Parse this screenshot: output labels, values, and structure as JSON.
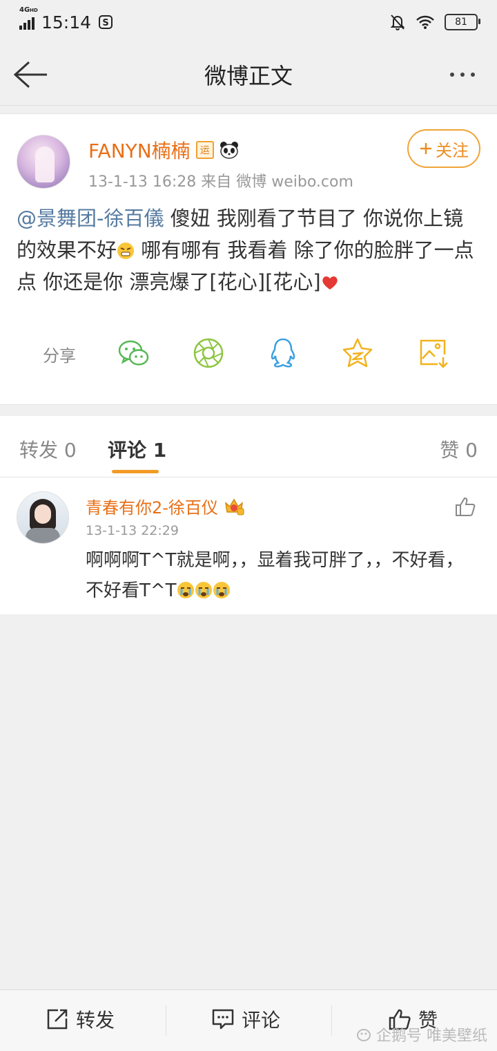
{
  "status_bar": {
    "network": "4G",
    "network_sub": "HD",
    "time": "15:14",
    "battery": "81"
  },
  "title_bar": {
    "title": "微博正文"
  },
  "post": {
    "username": "FANYN楠楠",
    "badge": "运",
    "meta": "13-1-13 16:28   来自 微博 weibo.com",
    "follow_label": "关注",
    "mention": "@景舞团-徐百儀",
    "text_a": " 傻妞 我刚看了节目了 你说你上镜的效果不好",
    "text_b": " 哪有哪有 我看着 除了你的脸胖了一点点 你还是你 漂亮爆了[花心][花心]"
  },
  "share": {
    "label": "分享",
    "icons": [
      "wechat-icon",
      "moments-icon",
      "qq-icon",
      "qzone-icon",
      "save-image-icon"
    ]
  },
  "tabs": {
    "repost": "转发 0",
    "comment": "评论 1",
    "like": "赞 0"
  },
  "comment": {
    "username": "青春有你2-徐百仪",
    "time": "13-1-13 22:29",
    "text": "啊啊啊T^T就是啊，，显着我可胖了，，不好看，不好看T^T"
  },
  "bottom_bar": {
    "repost": "转发",
    "comment": "评论",
    "like": "赞"
  },
  "watermark": "企鹅号 唯美壁纸",
  "colors": {
    "orange": "#e86f17",
    "accent": "#f29b27",
    "mention": "#557aa0",
    "green": "#56b854"
  }
}
